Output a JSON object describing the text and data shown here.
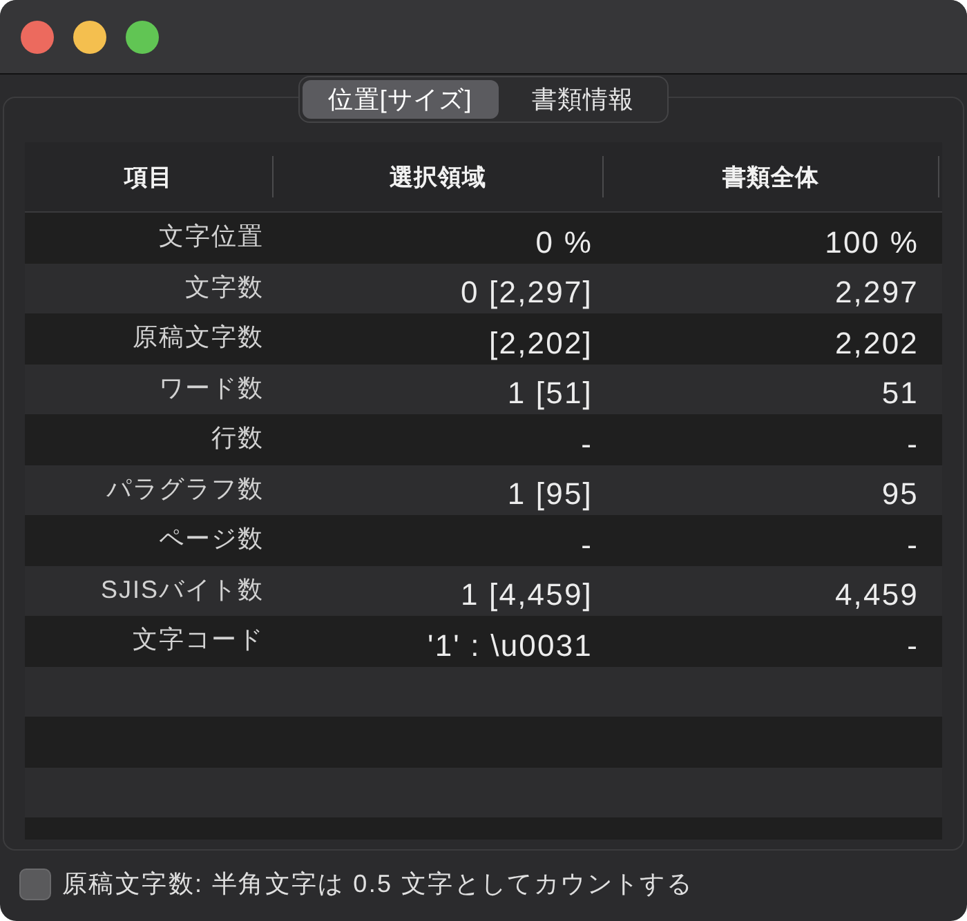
{
  "tabs": [
    {
      "label": "位置[サイズ]",
      "selected": true
    },
    {
      "label": "書類情報",
      "selected": false
    }
  ],
  "table": {
    "columns": [
      "項目",
      "選択領域",
      "書類全体"
    ],
    "rows": [
      {
        "item": "文字位置",
        "selection": "0 %",
        "document": "100 %"
      },
      {
        "item": "文字数",
        "selection": "0 [2,297]",
        "document": "2,297"
      },
      {
        "item": "原稿文字数",
        "selection": "[2,202]",
        "document": "2,202"
      },
      {
        "item": "ワード数",
        "selection": "1 [51]",
        "document": "51"
      },
      {
        "item": "行数",
        "selection": "-",
        "document": "-"
      },
      {
        "item": "パラグラフ数",
        "selection": "1 [95]",
        "document": "95"
      },
      {
        "item": "ページ数",
        "selection": "-",
        "document": "-"
      },
      {
        "item": "SJISバイト数",
        "selection": "1 [4,459]",
        "document": "4,459"
      },
      {
        "item": "文字コード",
        "selection": "'1' : \\u0031",
        "document": "-"
      }
    ]
  },
  "checkbox": {
    "label": "原稿文字数: 半角文字は 0.5 文字としてカウントする",
    "checked": false
  }
}
